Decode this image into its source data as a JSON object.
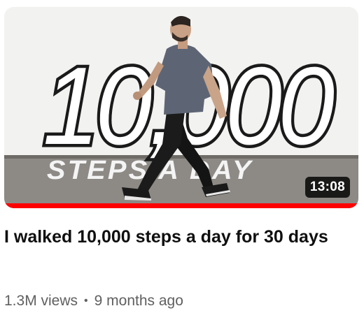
{
  "video": {
    "duration": "13:08",
    "title": "I walked 10,000 steps a day for 30 days",
    "views": "1.3M views",
    "separator": "•",
    "age": "9 months ago",
    "watch_progress": 1.0,
    "thumbnail_text_big": "10,000",
    "thumbnail_text_small": "STEPS A DAY"
  },
  "colors": {
    "progress": "#ff0000",
    "title": "#0f0f0f",
    "meta": "#606060"
  }
}
